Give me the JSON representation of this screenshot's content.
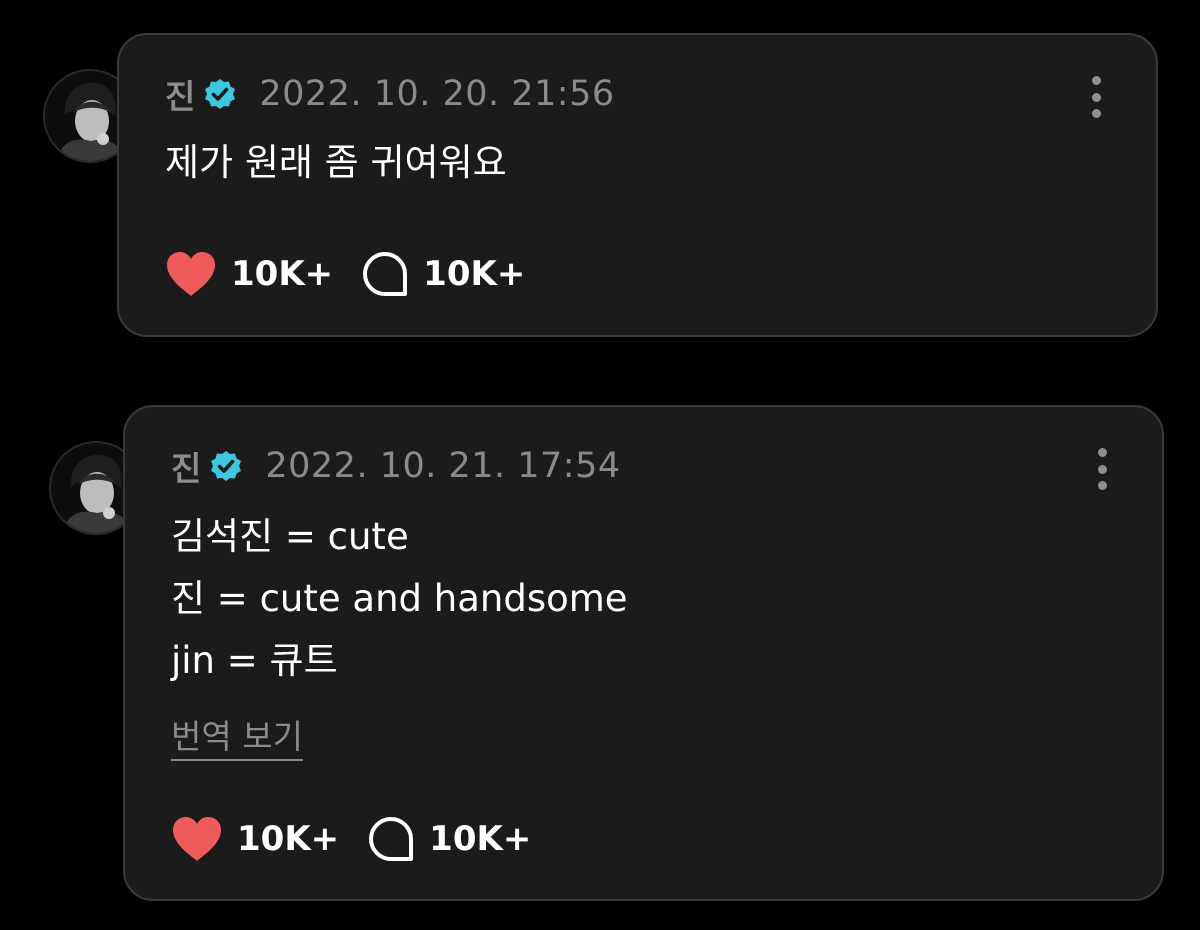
{
  "colors": {
    "background": "#000000",
    "card": "#1b1b1b",
    "verified": "#3ec6e0",
    "heart": "#ef5b5b"
  },
  "posts": [
    {
      "author": "진",
      "timestamp": "2022. 10. 20. 21:56",
      "lines": [
        "제가 원래 좀 귀여워요"
      ],
      "likes": "10K+",
      "comments": "10K+"
    },
    {
      "author": "진",
      "timestamp": "2022. 10. 21. 17:54",
      "lines": [
        "김석진 = cute",
        "진 = cute and handsome",
        "jin = 큐트"
      ],
      "translate_label": "번역 보기",
      "likes": "10K+",
      "comments": "10K+"
    }
  ],
  "icons": {
    "verified": "verified-badge-icon",
    "more": "more-options-icon",
    "like": "heart-icon",
    "comment": "comment-bubble-icon"
  }
}
